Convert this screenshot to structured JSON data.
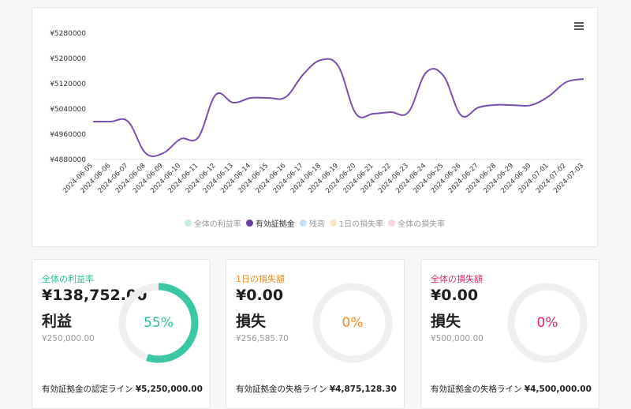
{
  "chart": {
    "legend": [
      {
        "label": "全体の利益率",
        "color": "#c8ede3",
        "active": false
      },
      {
        "label": "有効証拠金",
        "color": "#6a3fa0",
        "active": true
      },
      {
        "label": "残高",
        "color": "#c6e1f6",
        "active": false
      },
      {
        "label": "1日の損失率",
        "color": "#fde3c7",
        "active": false
      },
      {
        "label": "全体の損失率",
        "color": "#f9d6e2",
        "active": false
      }
    ]
  },
  "chart_data": {
    "type": "line",
    "x": [
      "2024-06-05",
      "2024-06-06",
      "2024-06-07",
      "2024-06-08",
      "2024-06-09",
      "2024-06-10",
      "2024-06-11",
      "2024-06-12",
      "2024-06-13",
      "2024-06-14",
      "2024-06-15",
      "2024-06-16",
      "2024-06-17",
      "2024-06-18",
      "2024-06-19",
      "2024-06-20",
      "2024-06-21",
      "2024-06-22",
      "2024-06-23",
      "2024-06-24",
      "2024-06-25",
      "2024-06-26",
      "2024-06-27",
      "2024-06-28",
      "2024-06-29",
      "2024-06-30",
      "2024-07-01",
      "2024-07-02",
      "2024-07-03"
    ],
    "series": [
      {
        "name": "有効証拠金",
        "color": "#7a4fb0",
        "values": [
          5000000,
          5000000,
          5000000,
          4900000,
          4900000,
          4945000,
          4950000,
          5085000,
          5060000,
          5075000,
          5075000,
          5078000,
          5150000,
          5195000,
          5175000,
          5025000,
          5025000,
          5030000,
          5030000,
          5155000,
          5145000,
          5020000,
          5045000,
          5053000,
          5052000,
          5052000,
          5080000,
          5125000,
          5135000
        ]
      }
    ],
    "yticks": [
      "¥4880000",
      "¥4960000",
      "¥5040000",
      "¥5120000",
      "¥5200000",
      "¥5280000"
    ],
    "ylim": [
      4880000,
      5280000
    ],
    "grid": false,
    "legend_position": "bottom"
  },
  "cards": [
    {
      "title": "全体の利益率",
      "title_color": "#2cbf9b",
      "amount": "¥138,752.00",
      "word": "利益",
      "base": "¥250,000.00",
      "footer_label": "有効証拠金の認定ライン ",
      "footer_value": "¥5,250,000.00",
      "percent_text": "55%",
      "percent": 55,
      "ring_color": "#3cc7a4",
      "text_color": "#2cbf9b"
    },
    {
      "title": "1日の損失額",
      "title_color": "#f08a2a",
      "amount": "¥0.00",
      "word": "損失",
      "base": "¥256,585.70",
      "footer_label": "有効証拠金の失格ライン ",
      "footer_value": "¥4,875,128.30",
      "percent_text": "0%",
      "percent": 0,
      "ring_color": "#f08a2a",
      "text_color": "#f08a2a"
    },
    {
      "title": "全体の損失額",
      "title_color": "#e2245e",
      "amount": "¥0.00",
      "word": "損失",
      "base": "¥500,000.00",
      "footer_label": "有効証拠金の失格ライン ",
      "footer_value": "¥4,500,000.00",
      "percent_text": "0%",
      "percent": 0,
      "ring_color": "#e2245e",
      "text_color": "#e2245e"
    }
  ]
}
